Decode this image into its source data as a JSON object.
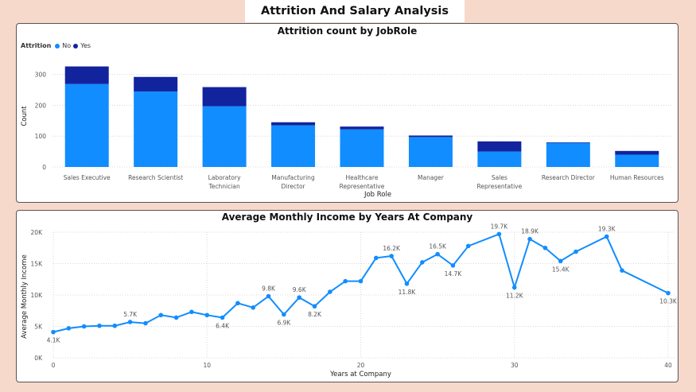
{
  "page_title": "Attrition And Salary Analysis",
  "chart_data": [
    {
      "type": "bar",
      "stacked": true,
      "title": "Attrition count by JobRole",
      "xlabel": "Job Role",
      "ylabel": "Count",
      "legend_title": "Attrition",
      "legend_position": "top-left",
      "categories": [
        "Sales Executive",
        "Research Scientist",
        "Laboratory Technician",
        "Manufacturing Director",
        "Healthcare Representative",
        "Manager",
        "Sales Representative",
        "Research Director",
        "Human Resources"
      ],
      "series": [
        {
          "name": "No",
          "color": "#118dff",
          "values": [
            269,
            245,
            197,
            135,
            122,
            97,
            50,
            78,
            40
          ]
        },
        {
          "name": "Yes",
          "color": "#12239e",
          "values": [
            57,
            47,
            62,
            10,
            9,
            5,
            33,
            2,
            12
          ]
        }
      ],
      "ylim": [
        0,
        330
      ],
      "yticks": [
        0,
        100,
        200,
        300
      ],
      "grid": true
    },
    {
      "type": "line",
      "title": "Average Monthly Income by Years At Company",
      "xlabel": "Years at Company",
      "ylabel": "Average Monthly Income",
      "xlim": [
        0,
        40
      ],
      "xticks": [
        0,
        10,
        20,
        30,
        40
      ],
      "ylim": [
        0,
        20000
      ],
      "yticks": [
        0,
        5000,
        10000,
        15000,
        20000
      ],
      "ytick_labels": [
        "0K",
        "5K",
        "10K",
        "15K",
        "20K"
      ],
      "grid": true,
      "series": [
        {
          "color": "#118dff",
          "x": [
            0,
            1,
            2,
            3,
            4,
            5,
            6,
            7,
            8,
            9,
            10,
            11,
            12,
            13,
            14,
            15,
            16,
            17,
            18,
            19,
            20,
            21,
            22,
            23,
            24,
            25,
            26,
            27,
            29,
            30,
            31,
            32,
            33,
            34,
            36,
            37,
            40
          ],
          "y": [
            4100,
            4700,
            5000,
            5100,
            5100,
            5700,
            5500,
            6800,
            6400,
            7300,
            6800,
            6400,
            8700,
            8000,
            9800,
            6900,
            9600,
            8200,
            10500,
            12200,
            12200,
            15900,
            16200,
            11800,
            15200,
            16500,
            14700,
            17800,
            19700,
            11200,
            18900,
            17500,
            15400,
            16900,
            19300,
            13900,
            10300
          ]
        }
      ],
      "data_labels": [
        {
          "x": 0,
          "label": "4.1K"
        },
        {
          "x": 5,
          "label": "5.7K"
        },
        {
          "x": 11,
          "label": "6.4K"
        },
        {
          "x": 14,
          "label": "9.8K"
        },
        {
          "x": 15,
          "label": "6.9K"
        },
        {
          "x": 16,
          "label": "9.6K"
        },
        {
          "x": 17,
          "label": "8.2K"
        },
        {
          "x": 22,
          "label": "16.2K"
        },
        {
          "x": 23,
          "label": "11.8K"
        },
        {
          "x": 25,
          "label": "16.5K"
        },
        {
          "x": 26,
          "label": "14.7K"
        },
        {
          "x": 29,
          "label": "19.7K"
        },
        {
          "x": 30,
          "label": "11.2K"
        },
        {
          "x": 31,
          "label": "18.9K"
        },
        {
          "x": 33,
          "label": "15.4K"
        },
        {
          "x": 36,
          "label": "19.3K"
        },
        {
          "x": 40,
          "label": "10.3K"
        }
      ]
    }
  ]
}
